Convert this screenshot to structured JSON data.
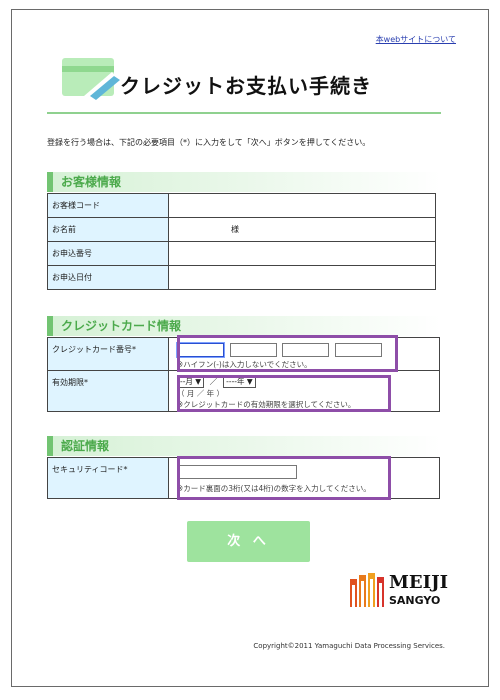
{
  "header": {
    "about_link": "本webサイトについて",
    "title": "クレジットお支払い手続き"
  },
  "instruction": "登録を行う場合は、下記の必要項目（*）に入力をして「次へ」ボタンを押してください。",
  "customer_section": {
    "title": "お客様情報",
    "rows": [
      {
        "label": "お客様コード",
        "value": ""
      },
      {
        "label": "お名前",
        "value": "様"
      },
      {
        "label": "お申込番号",
        "value": ""
      },
      {
        "label": "お申込日付",
        "value": ""
      }
    ]
  },
  "card_section": {
    "title": "クレジットカード情報",
    "card_number_label": "クレジットカード番号*",
    "card_number_hint": "※ハイフン(-)は入力しないでください。",
    "expiry_label": "有効期限*",
    "month_select": "--月",
    "year_select": "----年",
    "expiry_slash": "／",
    "expiry_sub": "（ 月 ／ 年 ）",
    "expiry_hint": "※クレジットカードの有効期限を選択してください。"
  },
  "auth_section": {
    "title": "認証情報",
    "security_label": "セキュリティコード*",
    "security_hint": "※カード裏面の3桁(又は4桁)の数字を入力してください。"
  },
  "next_button": "次 へ",
  "logo": {
    "line1": "MEIJI",
    "line2": "SANGYO"
  },
  "copyright": "Copyright©2011 Yamaguchi Data Processing Services.",
  "colors": {
    "accent_green": "#72c472",
    "button_green": "#9ee39e",
    "highlight_purple": "#8e4ea8",
    "label_bg": "#dff4ff"
  }
}
